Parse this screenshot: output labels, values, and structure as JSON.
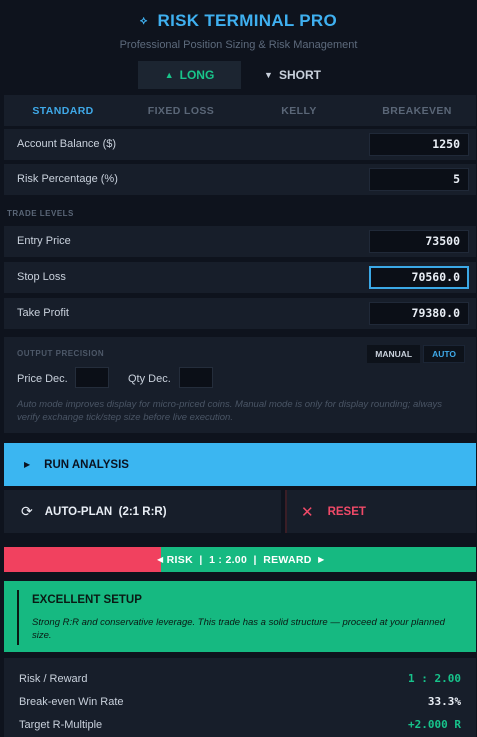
{
  "header": {
    "title": "RISK TERMINAL PRO",
    "subtitle": "Professional Position Sizing & Risk Management"
  },
  "direction": {
    "long_label": "LONG",
    "short_label": "SHORT",
    "selected": "LONG"
  },
  "tabs": [
    {
      "label": "STANDARD",
      "active": true
    },
    {
      "label": "FIXED LOSS",
      "active": false
    },
    {
      "label": "KELLY",
      "active": false
    },
    {
      "label": "BREAKEVEN",
      "active": false
    }
  ],
  "inputs": {
    "account_balance": {
      "label": "Account Balance ($)",
      "value": "1250"
    },
    "risk_percentage": {
      "label": "Risk Percentage (%)",
      "value": "5"
    }
  },
  "trade_levels": {
    "section_label": "TRADE LEVELS",
    "entry": {
      "label": "Entry Price",
      "value": "73500"
    },
    "stop": {
      "label": "Stop Loss",
      "value": "70560.0"
    },
    "take_profit": {
      "label": "Take Profit",
      "value": "79380.0"
    }
  },
  "precision": {
    "section_label": "OUTPUT PRECISION",
    "manual_label": "MANUAL",
    "auto_label": "AUTO",
    "selected_mode": "AUTO",
    "price_dec_label": "Price Dec.",
    "qty_dec_label": "Qty Dec.",
    "price_dec_value": "",
    "qty_dec_value": "",
    "help_text": "Auto mode improves display for micro-priced coins. Manual mode is only for display rounding; always verify exchange tick/step size before live execution."
  },
  "actions": {
    "run_label": "RUN ANALYSIS",
    "auto_plan_label": "AUTO-PLAN  (2:1 R:R)",
    "reset_label": "RESET"
  },
  "rr_bar": {
    "risk_label": "RISK",
    "ratio_label": "1 : 2.00",
    "reward_label": "REWARD",
    "risk_fraction": 0.333,
    "risk_color": "#f1415f",
    "reward_color": "#16b981"
  },
  "verdict": {
    "title": "EXCELLENT SETUP",
    "description": "Strong R:R and conservative leverage. This trade has a solid structure — proceed at your planned size.",
    "color": "#16b981"
  },
  "stats": [
    {
      "label": "Risk / Reward",
      "value": "1 : 2.00",
      "color": "#17c38b"
    },
    {
      "label": "Break-even Win Rate",
      "value": "33.3%",
      "color": "#e9eef5"
    },
    {
      "label": "Target R-Multiple",
      "value": "+2.000 R",
      "color": "#17c38b"
    }
  ],
  "colors": {
    "accent": "#3fb0f0",
    "long": "#19c58a",
    "danger": "#f04a68",
    "panel": "#171e2a",
    "background": "#0e131d"
  }
}
